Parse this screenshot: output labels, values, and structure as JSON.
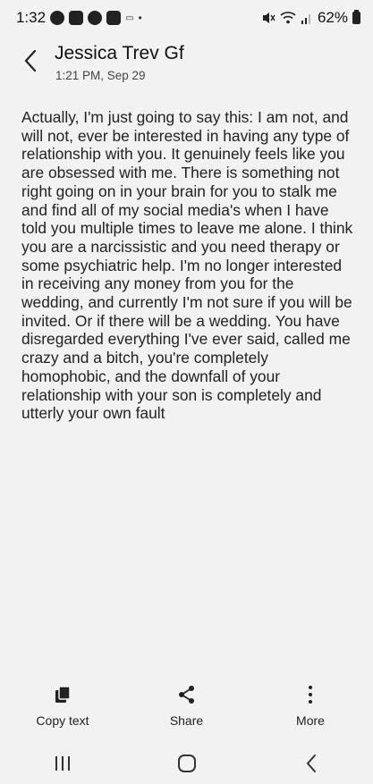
{
  "status_bar": {
    "time": "1:32",
    "notification_icons": [
      "facebook-icon",
      "w-app-icon",
      "n-app-icon",
      "w-app-icon"
    ],
    "battery_percent": "62%"
  },
  "header": {
    "title": "Jessica Trev Gf",
    "subtitle": "1:21 PM, Sep 29"
  },
  "message": {
    "text": "Actually, I'm just going to say this: I am not, and will not, ever be interested in having any type of relationship with you. It genuinely feels like you are obsessed with me. There is something not right going on in your brain for you to stalk me and find all of my social media's when I have told you multiple times to leave me alone. I think you are a narcissistic and you need therapy or some psychiatric help. I'm no longer interested in receiving any money from you for the wedding, and currently I'm not sure if you will be invited. Or if there will be a wedding. You have disregarded everything I've ever said, called me crazy and a bitch, you're completely homophobic, and the downfall of your relationship with your son is completely and utterly your own fault"
  },
  "actions": {
    "copy_label": "Copy text",
    "share_label": "Share",
    "more_label": "More"
  },
  "navbar": {
    "icons": [
      "recent-apps-icon",
      "home-icon",
      "back-icon"
    ]
  }
}
